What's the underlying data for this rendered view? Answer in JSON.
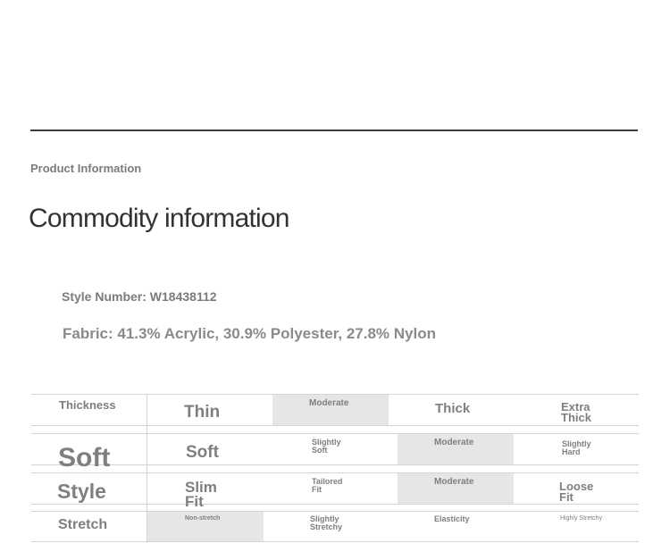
{
  "section_label": "Product Information",
  "page_title": "Commodity information",
  "style_number": "Style Number: W18438112",
  "fabric": "Fabric: 41.3% Acrylic, 30.9% Polyester, 27.8% Nylon",
  "table": {
    "rows": [
      {
        "label": "Thickness",
        "options": [
          "Thin",
          "Moderate",
          "Thick",
          "Extra Thick"
        ],
        "selected": "Moderate"
      },
      {
        "label": "Soft",
        "options": [
          "Soft",
          "Slightly Soft",
          "Moderate",
          "Slightly Hard"
        ],
        "selected": "Moderate"
      },
      {
        "label": "Style",
        "options": [
          "Slim Fit",
          "Tailored Fit",
          "Moderate",
          "Loose Fit"
        ],
        "selected": "Moderate"
      },
      {
        "label": "Stretch",
        "options": [
          "Non-stretch",
          "Slightly Stretchy",
          "Elasticity",
          "Highly Stretchy"
        ],
        "selected": "Non-stretch"
      }
    ]
  },
  "colors": {
    "text": "#7a7a7a",
    "title": "#333333",
    "rule": "#3a3a3a",
    "grid": "#d4d4d4",
    "highlight": "#e6e6e6"
  }
}
